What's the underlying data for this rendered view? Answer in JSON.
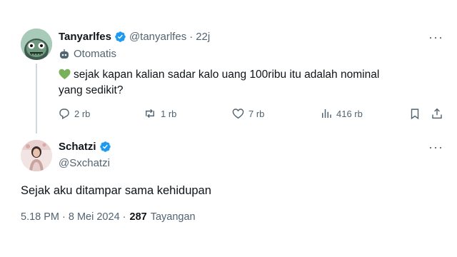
{
  "tweet1": {
    "display_name": "Tanyarlfes",
    "handle": "@tanyarlfes",
    "time_sep": "·",
    "time": "22j",
    "automated_label": "Otomatis",
    "text": "sejak kapan kalian sadar kalo uang 100ribu itu adalah nominal yang sedikit?",
    "replies": "2 rb",
    "retweets": "1 rb",
    "likes": "7 rb",
    "views": "416 rb"
  },
  "tweet2": {
    "display_name": "Schatzi",
    "handle": "@Sxchatzi",
    "text": "Sejak aku ditampar sama kehidupan",
    "timestamp": "5.18 PM · 8 Mei 2024 ·",
    "view_count": "287",
    "view_label": "Tayangan"
  },
  "colors": {
    "verified": "#1d9bf0",
    "muted": "#536471",
    "heart": "#78b159"
  },
  "icons": [
    "verified-badge-icon",
    "bot-icon",
    "green-heart-emoji",
    "reply-icon",
    "retweet-icon",
    "like-icon",
    "views-icon",
    "bookmark-icon",
    "share-icon",
    "more-icon"
  ]
}
